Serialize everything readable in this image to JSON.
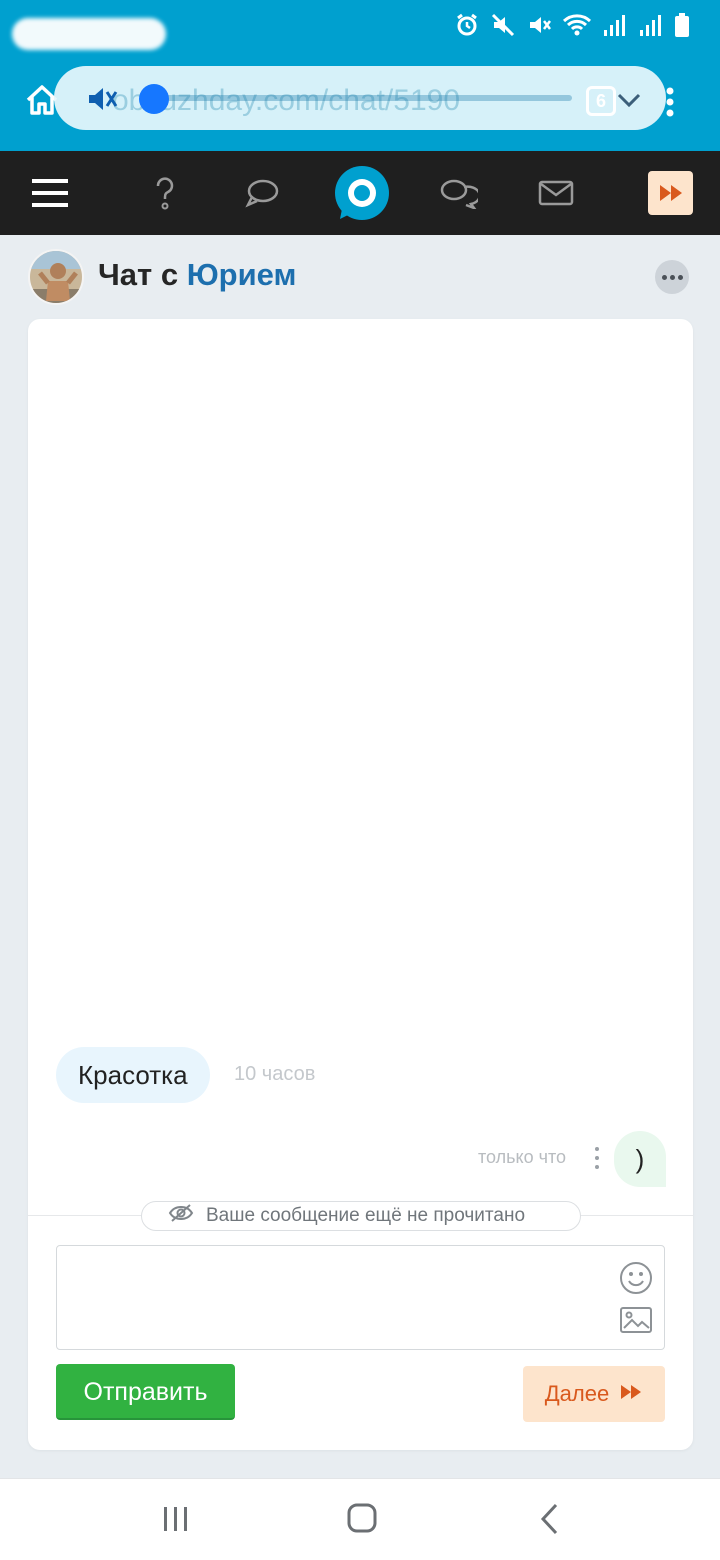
{
  "browser": {
    "url": "obsuzhday.com/chat/5190",
    "tab_count": "6"
  },
  "nav": {
    "items": [
      "menu-icon",
      "question-icon",
      "chat-bubble-icon",
      "logo-icon",
      "messages-icon",
      "mail-icon",
      "forward-icon"
    ]
  },
  "chat": {
    "title_prefix": "Чат с",
    "title_name": "Юрием",
    "messages": [
      {
        "direction": "in",
        "text": "Красотка",
        "time": "10 часов"
      },
      {
        "direction": "out",
        "text": ")",
        "time": "только что"
      }
    ],
    "unread_notice": "Ваше сообщение ещё не прочитано"
  },
  "composer": {
    "value": "",
    "send_label": "Отправить",
    "next_label": "Далее"
  },
  "colors": {
    "browser_bar": "#00a0cf",
    "nav_dark": "#1f1f1f",
    "accent_blue": "#1d6fae",
    "send_green": "#31b241",
    "next_orange_text": "#d9591d",
    "next_orange_bg": "#fde4cc"
  }
}
